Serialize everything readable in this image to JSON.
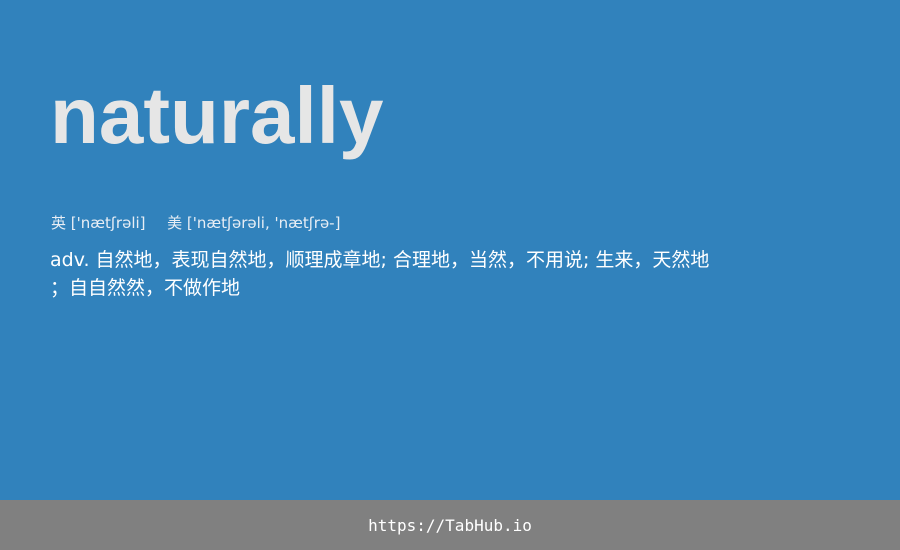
{
  "word": "naturally",
  "phonetics": {
    "uk_label": "英",
    "uk_ipa": "['nætʃrəli]",
    "us_label": "美",
    "us_ipa": "['nætʃərəli, 'nætʃrə-]"
  },
  "definition": {
    "line1": "adv. 自然地，表现自然地，顺理成章地; 合理地，当然，不用说; 生来，天然地",
    "line2": "；自自然然，不做作地"
  },
  "footer": {
    "url": "https://TabHub.io"
  },
  "colors": {
    "background": "#3182bc",
    "footer": "#808080",
    "word": "#e6e6e6"
  }
}
